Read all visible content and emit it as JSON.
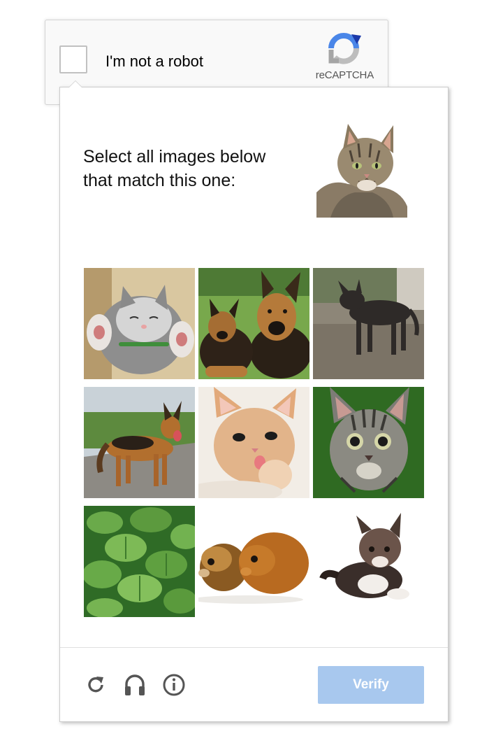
{
  "widget": {
    "checkbox_label": "I'm not a robot",
    "brand": "reCAPTCHA",
    "logo_icon": "recaptcha-logo-icon"
  },
  "challenge": {
    "instruction_line1": "Select all images below",
    "instruction_line2": "that match this one:",
    "reference_image": "tabby-cat",
    "tiles": [
      {
        "subject": "kitten-sleeping"
      },
      {
        "subject": "german-shepherd-with-puppy"
      },
      {
        "subject": "dark-dog"
      },
      {
        "subject": "german-shepherd-standing"
      },
      {
        "subject": "orange-kitten"
      },
      {
        "subject": "tabby-kitten"
      },
      {
        "subject": "green-leaves"
      },
      {
        "subject": "guinea-pigs"
      },
      {
        "subject": "fluffy-kitten"
      }
    ]
  },
  "footer": {
    "reload_icon": "reload-icon",
    "audio_icon": "headphones-icon",
    "info_icon": "info-icon",
    "verify_label": "Verify"
  },
  "colors": {
    "verify_button": "#a8c8ee",
    "logo_blue": "#4a86e8",
    "logo_gray": "#bdbdbd"
  }
}
